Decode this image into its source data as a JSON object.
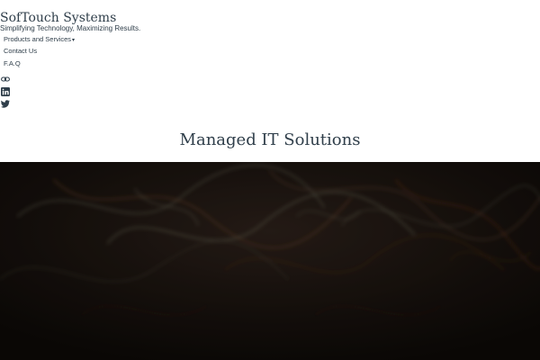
{
  "header": {
    "site_title": "SofTouch Systems",
    "tagline": "Simplifying Technology, Maximizing Results."
  },
  "nav": {
    "items": [
      {
        "label": "Products and Services",
        "has_dropdown": true
      },
      {
        "label": "Contact Us"
      },
      {
        "label": "F.A.Q"
      }
    ],
    "social_icons": [
      "link-icon",
      "linkedin-icon",
      "twitter-icon"
    ]
  },
  "hero": {
    "title": "Managed IT Solutions"
  },
  "colors": {
    "text": "#2f3e4a",
    "background": "#ffffff",
    "hero_background": "#120d0a"
  }
}
